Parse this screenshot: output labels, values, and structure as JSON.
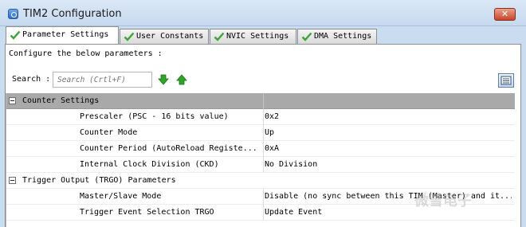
{
  "window": {
    "title": "TIM2 Configuration",
    "close_label": "✕"
  },
  "tabs": [
    {
      "label": "Parameter Settings",
      "active": true
    },
    {
      "label": "User Constants",
      "active": false
    },
    {
      "label": "NVIC Settings",
      "active": false
    },
    {
      "label": "DMA Settings",
      "active": false
    }
  ],
  "panel": {
    "configure_text": "Configure the below parameters :",
    "search_label": "Search :",
    "search_placeholder": "Search (Crtl+F)"
  },
  "groups": [
    {
      "label": "Counter Settings",
      "params": [
        {
          "label": "Prescaler (PSC - 16 bits value)",
          "value": "0x2"
        },
        {
          "label": "Counter Mode",
          "value": "Up"
        },
        {
          "label": "Counter Period (AutoReload Registe...",
          "value": "0xA"
        },
        {
          "label": "Internal Clock Division (CKD)",
          "value": "No Division"
        }
      ]
    },
    {
      "label": "Trigger Output (TRGO) Parameters",
      "params": [
        {
          "label": "Master/Slave Mode",
          "value": "Disable (no sync between this TIM (Master) and it..."
        },
        {
          "label": "Trigger Event Selection TRGO",
          "value": "Update Event"
        }
      ]
    }
  ],
  "colors": {
    "title_bar": "#c6d9ee",
    "group_header": "#a9a9a9",
    "check_green": "#3da336",
    "arrow_green": "#2fa32a"
  },
  "watermark": "微雪电子"
}
